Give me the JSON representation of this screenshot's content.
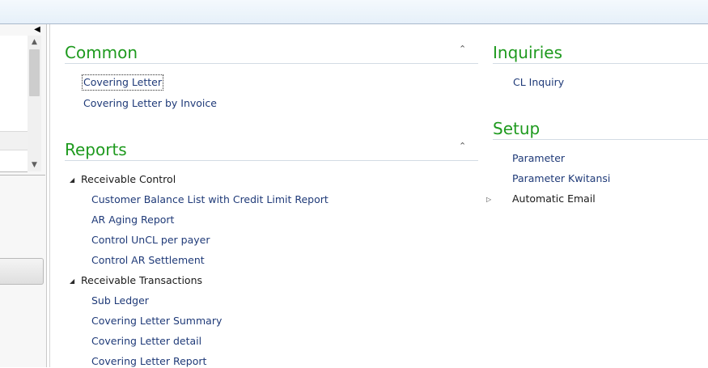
{
  "colors": {
    "group_title": "#1e9a1e",
    "link": "#1f3a78",
    "node": "#1a1a1a",
    "divider": "#d3dbe4"
  },
  "left_pane": {
    "collapse_icon": "chevron-left-icon",
    "scroll_up_icon": "scroll-up-icon",
    "scroll_down_icon": "scroll-down-icon"
  },
  "groups": {
    "common": {
      "title": "Common",
      "toggle_icon": "chevron-up-icon",
      "items": [
        "Covering Letter",
        "Covering Letter by Invoice"
      ]
    },
    "reports": {
      "title": "Reports",
      "toggle_icon": "chevron-up-icon",
      "nodes": [
        {
          "label": "Receivable Control",
          "expanded": true,
          "children": [
            "Customer Balance List with Credit Limit Report",
            "AR Aging Report",
            "Control UnCL per payer",
            "Control AR Settlement"
          ]
        },
        {
          "label": "Receivable Transactions",
          "expanded": true,
          "children": [
            "Sub Ledger",
            "Covering Letter Summary",
            "Covering Letter detail",
            "Covering Letter Report"
          ]
        }
      ]
    },
    "inquiries": {
      "title": "Inquiries",
      "items": [
        "CL Inquiry"
      ]
    },
    "setup": {
      "title": "Setup",
      "items": [
        "Parameter",
        "Parameter Kwitansi"
      ],
      "nodes": [
        {
          "label": "Automatic Email",
          "expanded": false
        }
      ]
    }
  }
}
